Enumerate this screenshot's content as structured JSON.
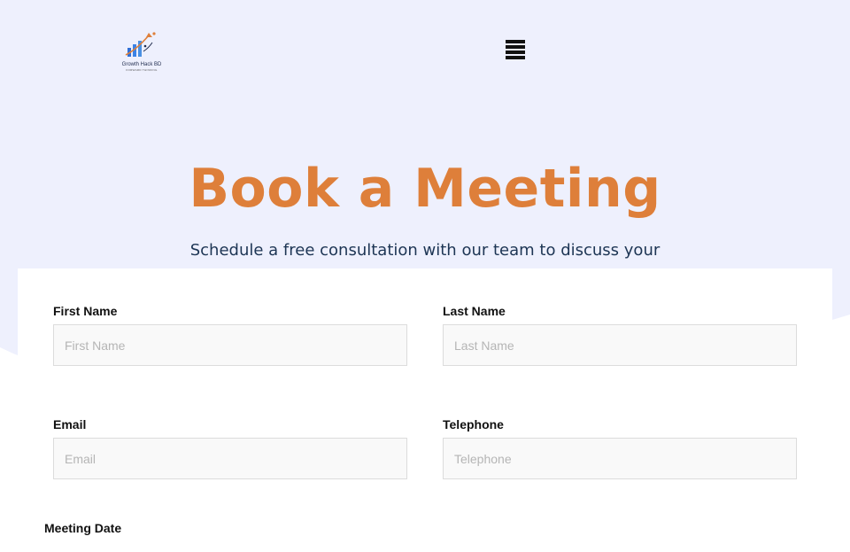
{
  "header": {
    "logo_name": "Growth Hack BD",
    "logo_tagline": "FORWARD THINKING",
    "menu_icon": "hamburger-menu-icon"
  },
  "hero": {
    "title": "Book a Meeting",
    "subtitle": "Schedule a free consultation with our team to discuss your"
  },
  "form": {
    "first_name": {
      "label": "First Name",
      "placeholder": "First Name",
      "value": ""
    },
    "last_name": {
      "label": "Last Name",
      "placeholder": "Last Name",
      "value": ""
    },
    "email": {
      "label": "Email",
      "placeholder": "Email",
      "value": ""
    },
    "telephone": {
      "label": "Telephone",
      "placeholder": "Telephone",
      "value": ""
    },
    "meeting_date": {
      "label": "Meeting Date"
    }
  },
  "colors": {
    "hero_background": "#eef0fd",
    "title_accent": "#de7f3a",
    "subtitle_text": "#1d3554",
    "input_background": "#f9f9f9",
    "input_border": "#dcdcdc"
  }
}
